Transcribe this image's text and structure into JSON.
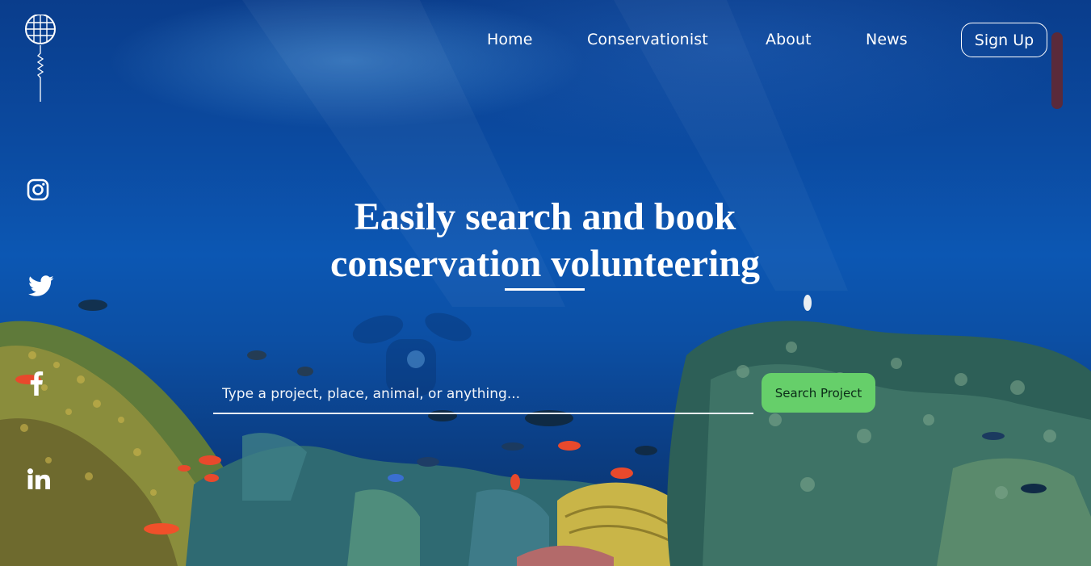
{
  "nav": {
    "home": "Home",
    "conservationist": "Conservationist",
    "about": "About",
    "news": "News",
    "signup": "Sign Up"
  },
  "social": [
    "instagram-icon",
    "twitter-icon",
    "facebook-icon",
    "linkedin-icon"
  ],
  "hero": {
    "line1": "Easily search and book",
    "line2": "conservation volunteering"
  },
  "search": {
    "placeholder": "Type a project, place, animal, or anything...",
    "button": "Search Project"
  },
  "colors": {
    "accent": "#66cf6a",
    "water": "#0c57b3"
  }
}
